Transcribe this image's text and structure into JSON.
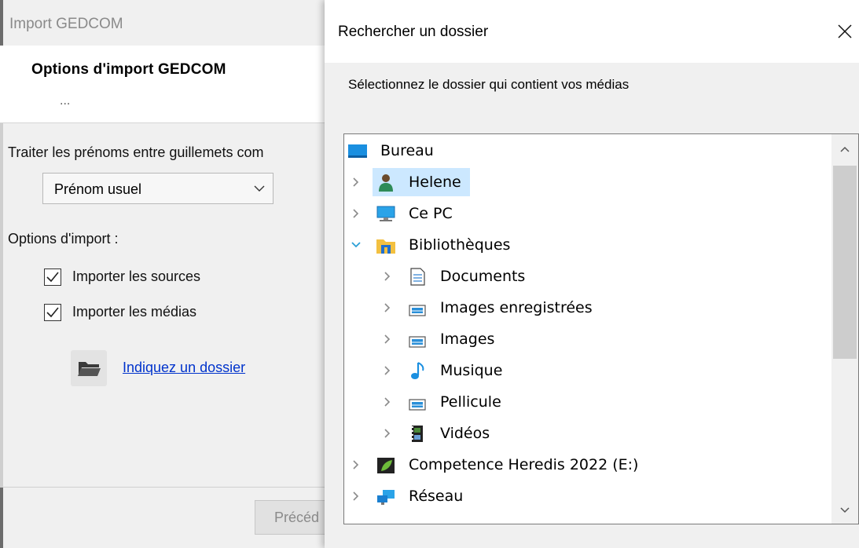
{
  "import_window": {
    "title": "Import GEDCOM",
    "heading": "Options d'import GEDCOM",
    "heading_dots": "...",
    "prenoms_label": "Traiter les prénoms entre guillemets com",
    "prenoms_select_value": "Prénom usuel",
    "options_label": "Options d'import :",
    "checkbox_sources": {
      "label": "Importer les sources",
      "checked": true
    },
    "checkbox_medias": {
      "label": "Importer les médias",
      "checked": true
    },
    "folder_link": "Indiquez un dossier",
    "previous_button": "Précéd"
  },
  "dialog": {
    "title": "Rechercher un dossier",
    "instruction": "Sélectionnez le dossier qui contient vos médias",
    "tree": [
      {
        "label": "Bureau",
        "icon": "desktop-icon",
        "level": 0,
        "chevron": "none",
        "selected": false
      },
      {
        "label": "Helene",
        "icon": "user-icon",
        "level": 1,
        "chevron": "collapsed",
        "selected": true
      },
      {
        "label": "Ce PC",
        "icon": "computer-icon",
        "level": 1,
        "chevron": "collapsed",
        "selected": false
      },
      {
        "label": "Bibliothèques",
        "icon": "library-icon",
        "level": 1,
        "chevron": "expanded",
        "selected": false
      },
      {
        "label": "Documents",
        "icon": "documents-icon",
        "level": 2,
        "chevron": "collapsed",
        "selected": false
      },
      {
        "label": "Images enregistrées",
        "icon": "pictures-icon",
        "level": 2,
        "chevron": "collapsed",
        "selected": false
      },
      {
        "label": "Images",
        "icon": "pictures-icon",
        "level": 2,
        "chevron": "collapsed",
        "selected": false
      },
      {
        "label": "Musique",
        "icon": "music-icon",
        "level": 2,
        "chevron": "collapsed",
        "selected": false
      },
      {
        "label": "Pellicule",
        "icon": "pictures-icon",
        "level": 2,
        "chevron": "collapsed",
        "selected": false
      },
      {
        "label": "Vidéos",
        "icon": "videos-icon",
        "level": 2,
        "chevron": "collapsed",
        "selected": false
      },
      {
        "label": "Competence Heredis 2022 (E:)",
        "icon": "drive-icon",
        "level": 1,
        "chevron": "collapsed",
        "selected": false
      },
      {
        "label": "Réseau",
        "icon": "network-icon",
        "level": 1,
        "chevron": "collapsed",
        "selected": false
      },
      {
        "label": "",
        "icon": "folder-icon",
        "level": 1,
        "chevron": "none",
        "selected": false
      }
    ]
  },
  "colors": {
    "selection": "#cce8ff",
    "link": "#0033cc",
    "expanded_chevron": "#2a9fd6"
  }
}
